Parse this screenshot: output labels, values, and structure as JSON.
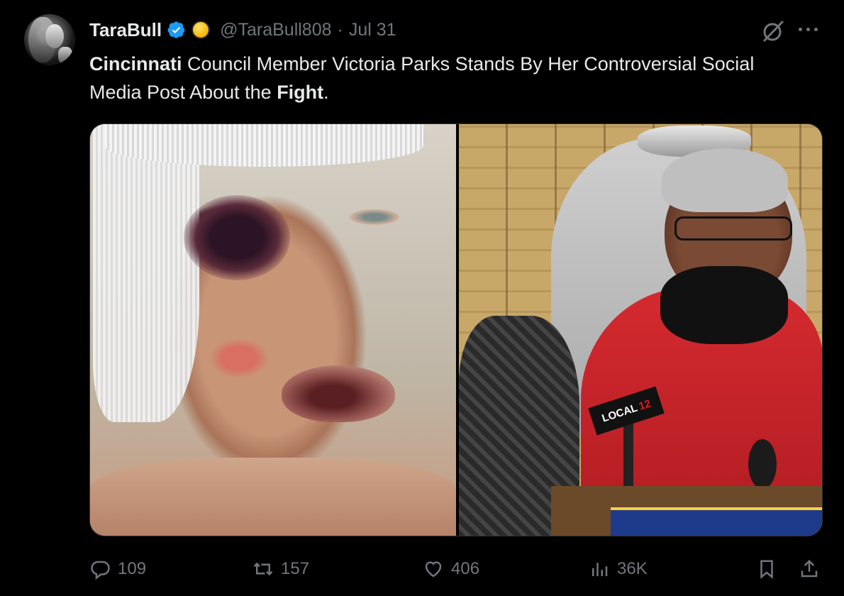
{
  "author": {
    "display_name": "TaraBull",
    "handle": "@TaraBull808",
    "separator": "·",
    "date": "Jul 31"
  },
  "tweet": {
    "segments": [
      {
        "text": "Cincinnati",
        "bold": true
      },
      {
        "text": " Council Member Victoria Parks Stands By Her Controversial Social Media Post About the ",
        "bold": false
      },
      {
        "text": "Fight",
        "bold": true
      },
      {
        "text": ".",
        "bold": false
      }
    ]
  },
  "media": {
    "left_image": "photo-bruised-face",
    "right_image": "photo-press-conference",
    "mic_flag_text": "LOCAL",
    "mic_flag_number": "12"
  },
  "actions": {
    "replies": "109",
    "retweets": "157",
    "likes": "406",
    "views": "36K"
  },
  "colors": {
    "background": "#000000",
    "text": "#e7e9ea",
    "muted": "#71767b",
    "verified": "#1d9bf0"
  },
  "icons": [
    "grok-icon",
    "more-icon",
    "reply-icon",
    "retweet-icon",
    "like-icon",
    "views-icon",
    "bookmark-icon",
    "share-icon",
    "verified-icon"
  ]
}
